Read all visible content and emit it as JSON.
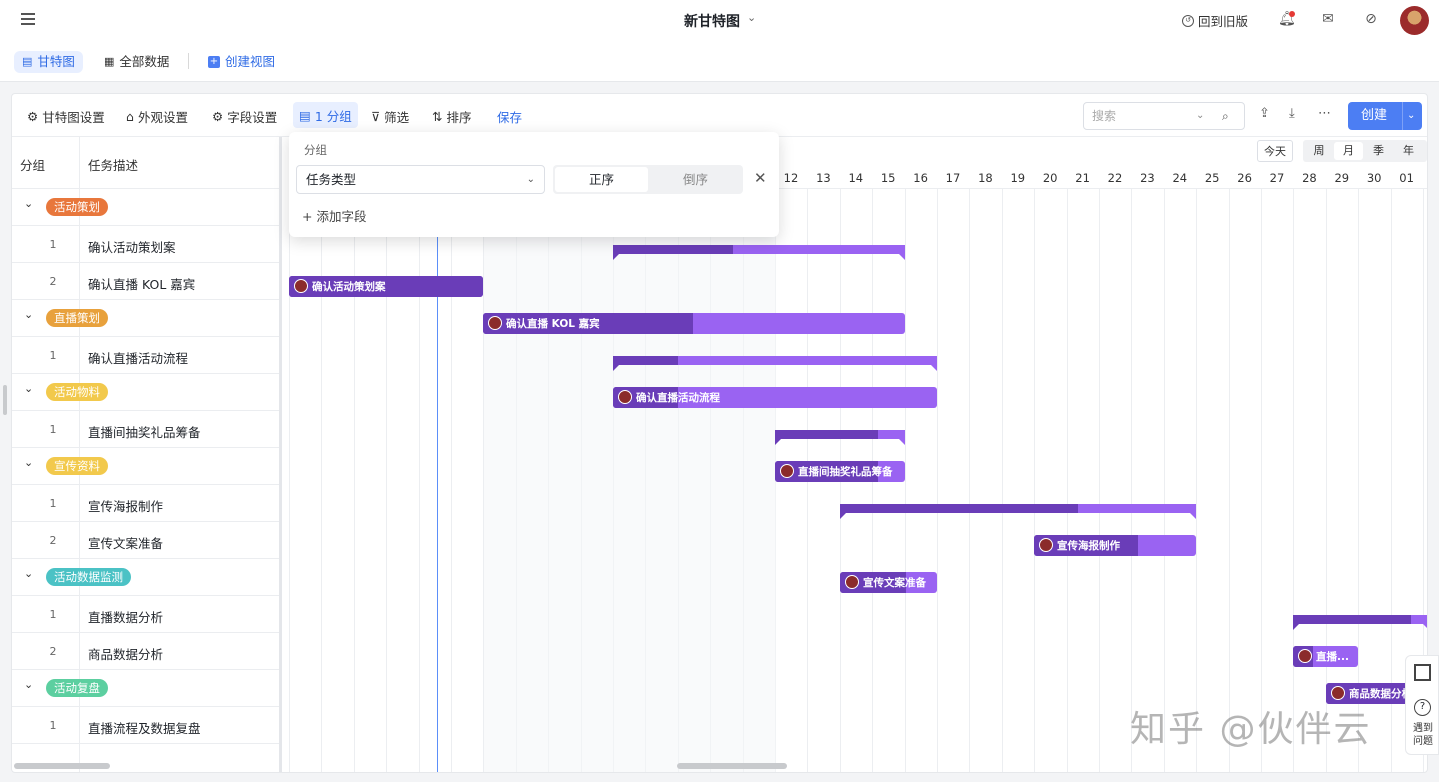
{
  "topbar": {
    "title": "新甘特图",
    "back_old": "回到旧版"
  },
  "viewbar": {
    "tabs": [
      "甘特图",
      "全部数据"
    ],
    "create_view": "创建视图"
  },
  "toolbar": {
    "gantt_settings": "甘特图设置",
    "appearance": "外观设置",
    "fields": "字段设置",
    "group": "1 分组",
    "filter": "筛选",
    "sort": "排序",
    "save": "保存",
    "search_placeholder": "搜索",
    "create": "创建"
  },
  "left_table": {
    "headers": [
      "分组",
      "任务描述"
    ],
    "groups": [
      {
        "tag": "活动策划",
        "color": "#e8773c",
        "tasks": [
          {
            "num": "1",
            "text": "确认活动策划案"
          },
          {
            "num": "2",
            "text": "确认直播 KOL 嘉宾"
          }
        ]
      },
      {
        "tag": "直播策划",
        "color": "#e8a13c",
        "tasks": [
          {
            "num": "1",
            "text": "确认直播活动流程"
          }
        ]
      },
      {
        "tag": "活动物料",
        "color": "#f2c94c",
        "tasks": [
          {
            "num": "1",
            "text": "直播间抽奖礼品筹备"
          }
        ]
      },
      {
        "tag": "宣传资料",
        "color": "#f2c94c",
        "tasks": [
          {
            "num": "1",
            "text": "宣传海报制作"
          },
          {
            "num": "2",
            "text": "宣传文案准备"
          }
        ]
      },
      {
        "tag": "活动数据监测",
        "color": "#4bc2c5",
        "tasks": [
          {
            "num": "1",
            "text": "直播数据分析"
          },
          {
            "num": "2",
            "text": "商品数据分析"
          }
        ]
      },
      {
        "tag": "活动复盘",
        "color": "#5ccfa0",
        "tasks": [
          {
            "num": "1",
            "text": "直播流程及数据复盘"
          }
        ]
      }
    ]
  },
  "gantt": {
    "today_btn": "今天",
    "scale_btns": [
      "周",
      "月",
      "季",
      "年"
    ],
    "days": [
      "12",
      "13",
      "14",
      "15",
      "16",
      "17",
      "18",
      "19",
      "20",
      "21",
      "22",
      "23",
      "24",
      "25",
      "26",
      "27",
      "28",
      "29",
      "30",
      "01"
    ],
    "bars": [
      "确认活动策划案",
      "确认直播 KOL 嘉宾",
      "确认直播活动流程",
      "直播间抽奖礼品筹备",
      "宣传海报制作",
      "宣传文案准备",
      "直播...",
      "商品数据分析"
    ]
  },
  "group_popup": {
    "title": "分组",
    "field": "任务类型",
    "asc": "正序",
    "desc": "倒序",
    "add_field": "添加字段"
  },
  "side_float": {
    "help": "遇到问题"
  },
  "watermark": "知乎 @伙伴云"
}
